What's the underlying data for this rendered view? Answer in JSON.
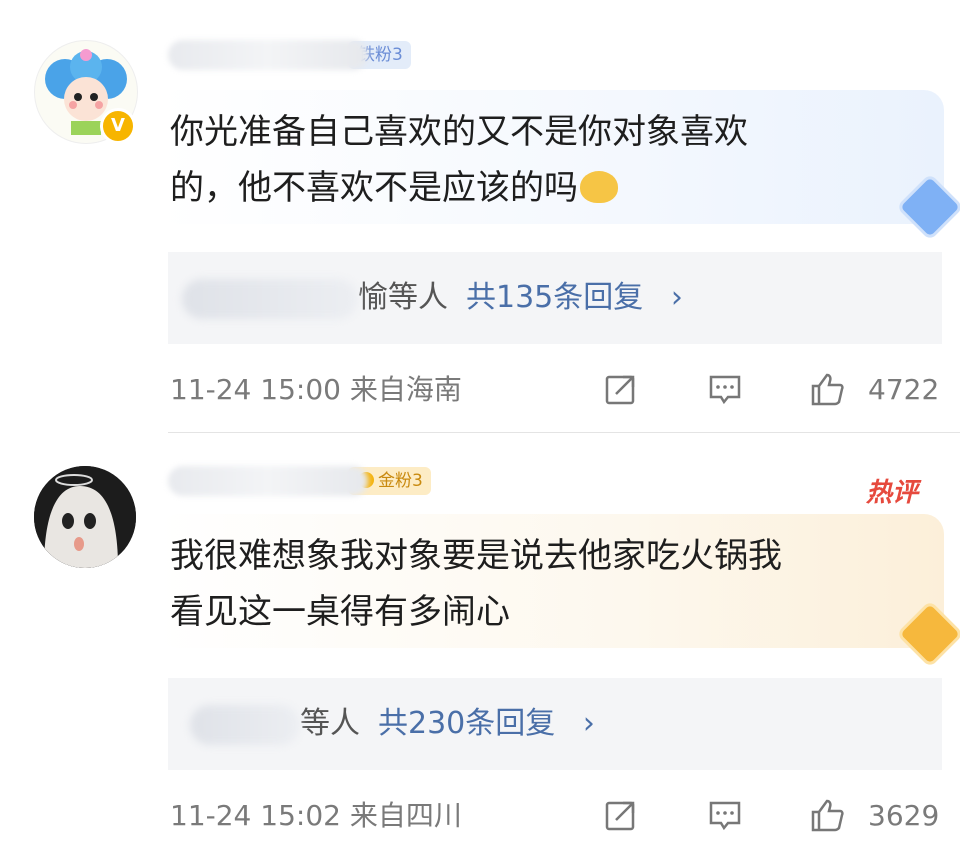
{
  "comments": [
    {
      "fan_badge": "铁粉3",
      "text_line1": "你光准备自己喜欢的又不是你对象喜欢",
      "text_line2": "的，他不喜欢不是应该的吗",
      "reply_suffix": "愉等人",
      "reply_count_label": "共135条回复",
      "reply_chevron": "›",
      "timestamp": "11-24 15:00",
      "location": "来自海南",
      "like_count": "4722",
      "verified_badge": "V",
      "icons": [
        "share-icon",
        "comment-icon",
        "like-icon",
        "emoji-icon",
        "diamond-icon"
      ]
    },
    {
      "fan_badge": "金粉3",
      "hot_tag": "热评",
      "text_line1": "我很难想象我对象要是说去他家吃火锅我",
      "text_line2": "看见这一桌得有多闹心",
      "reply_suffix": "等人",
      "reply_count_label": "共230条回复",
      "reply_chevron": "›",
      "timestamp": "11-24 15:02",
      "location": "来自四川",
      "like_count": "3629",
      "icons": [
        "share-icon",
        "comment-icon",
        "like-icon",
        "crown-badge-icon"
      ]
    }
  ],
  "colors": {
    "link_blue": "#4a6fa8",
    "hot_red": "#e6493d",
    "reply_bg": "#f4f5f7",
    "iron_fan": "#6b8dd6",
    "gold_fan": "#c98a0f"
  }
}
